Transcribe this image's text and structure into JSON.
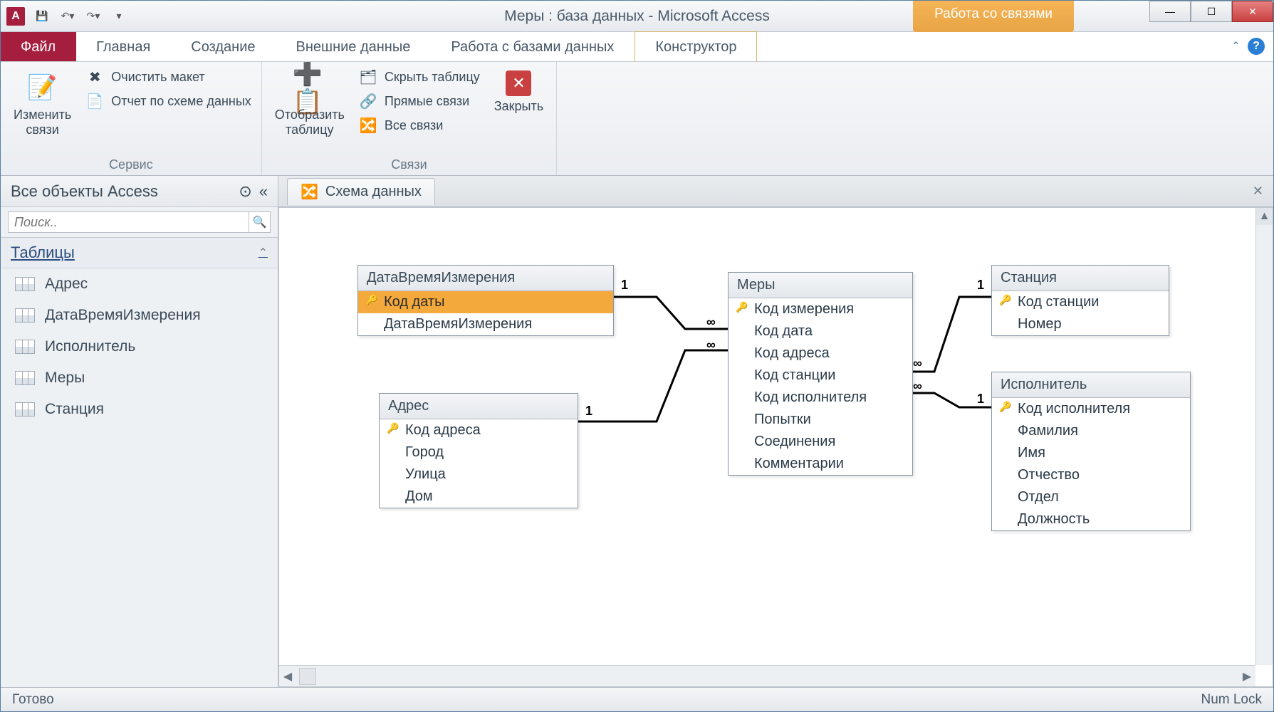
{
  "title": "Меры : база данных  -  Microsoft Access",
  "context_tab_group": "Работа со связями",
  "ribbon_tabs": {
    "file": "Файл",
    "home": "Главная",
    "create": "Создание",
    "external": "Внешние данные",
    "dbtools": "Работа с базами данных",
    "design": "Конструктор"
  },
  "ribbon": {
    "group1_label": "Сервис",
    "edit_rel": "Изменить\nсвязи",
    "clear_layout": "Очистить макет",
    "report": "Отчет по схеме данных",
    "group2_label": "Связи",
    "show_table": "Отобразить\nтаблицу",
    "hide_table": "Скрыть таблицу",
    "direct_rel": "Прямые связи",
    "all_rel": "Все связи",
    "close": "Закрыть"
  },
  "nav": {
    "header": "Все объекты Access",
    "search_placeholder": "Поиск..",
    "group": "Таблицы",
    "items": [
      "Адрес",
      "ДатаВремяИзмерения",
      "Исполнитель",
      "Меры",
      "Станция"
    ]
  },
  "doc_tab": "Схема данных",
  "tables": {
    "t1": {
      "title": "ДатаВремяИзмерения",
      "fields": [
        "Код даты",
        "ДатаВремяИзмерения"
      ],
      "pk": [
        0
      ],
      "selected": 0
    },
    "t2": {
      "title": "Адрес",
      "fields": [
        "Код адреса",
        "Город",
        "Улица",
        "Дом"
      ],
      "pk": [
        0
      ]
    },
    "t3": {
      "title": "Меры",
      "fields": [
        "Код измерения",
        "Код дата",
        "Код адреса",
        "Код станции",
        "Код исполнителя",
        "Попытки",
        "Соединения",
        "Комментарии"
      ],
      "pk": [
        0
      ]
    },
    "t4": {
      "title": "Станция",
      "fields": [
        "Код станции",
        "Номер"
      ],
      "pk": [
        0
      ]
    },
    "t5": {
      "title": "Исполнитель",
      "fields": [
        "Код исполнителя",
        "Фамилия",
        "Имя",
        "Отчество",
        "Отдел",
        "Должность"
      ],
      "pk": [
        0
      ]
    }
  },
  "rel_labels": {
    "one": "1",
    "many": "∞"
  },
  "status": {
    "left": "Готово",
    "right": "Num Lock"
  }
}
